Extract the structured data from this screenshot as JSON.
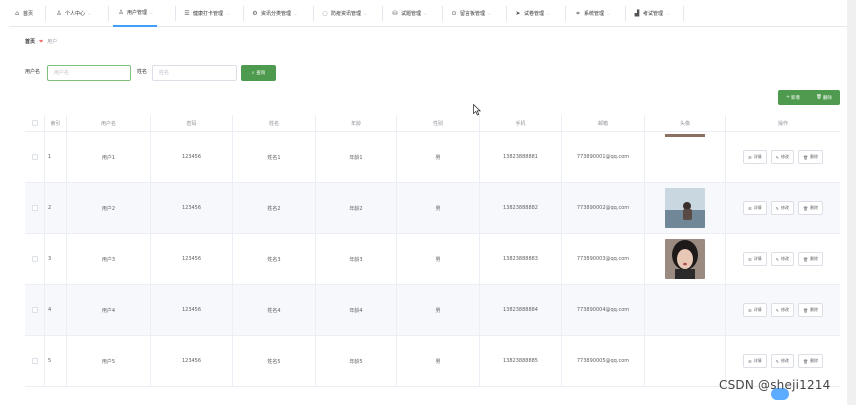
{
  "topnav": {
    "items": [
      {
        "label": "首页",
        "icon": "home-icon"
      },
      {
        "label": "个人中心",
        "icon": "user-icon"
      },
      {
        "label": "用户管理",
        "icon": "user-icon"
      },
      {
        "label": "健康打卡管理",
        "icon": "list-icon"
      },
      {
        "label": "资讯分类管理",
        "icon": "gear-icon"
      },
      {
        "label": "防疫资讯管理",
        "icon": "chat-icon"
      },
      {
        "label": "试题管理",
        "icon": "database-icon"
      },
      {
        "label": "留言板管理",
        "icon": "pin-icon"
      },
      {
        "label": "试卷管理",
        "icon": "send-icon"
      },
      {
        "label": "系统管理",
        "icon": "crop-icon"
      },
      {
        "label": "考试管理",
        "icon": "chart-icon"
      }
    ]
  },
  "breadcrumb": {
    "home": "首页",
    "current": "用户"
  },
  "search": {
    "username_label": "用户名",
    "username_placeholder": "用户名",
    "name_label": "姓名",
    "name_placeholder": "姓名",
    "button_label": "查询"
  },
  "actions": {
    "add_label": "新增",
    "delete_label": "删除"
  },
  "table": {
    "headers": [
      "索引",
      "用户名",
      "密码",
      "姓名",
      "年龄",
      "性别",
      "手机",
      "邮箱",
      "头像",
      "操作"
    ],
    "row_ops": [
      "详情",
      "修改",
      "删除"
    ],
    "rows": [
      {
        "index": "1",
        "username": "用户1",
        "password": "123456",
        "name": "姓名1",
        "age": "年龄1",
        "gender": "男",
        "phone": "13823888881",
        "email": "773890001@qq.com",
        "avatar": "none"
      },
      {
        "index": "2",
        "username": "用户2",
        "password": "123456",
        "name": "姓名2",
        "age": "年龄2",
        "gender": "男",
        "phone": "13823888882",
        "email": "773890002@qq.com",
        "avatar": "photo-seaside"
      },
      {
        "index": "3",
        "username": "用户3",
        "password": "123456",
        "name": "姓名3",
        "age": "年龄3",
        "gender": "男",
        "phone": "13823888883",
        "email": "773890003@qq.com",
        "avatar": "photo-portrait"
      },
      {
        "index": "4",
        "username": "用户4",
        "password": "123456",
        "name": "姓名4",
        "age": "年龄4",
        "gender": "男",
        "phone": "13823888884",
        "email": "773890004@qq.com",
        "avatar": "none"
      },
      {
        "index": "5",
        "username": "用户5",
        "password": "123456",
        "name": "姓名5",
        "age": "年龄5",
        "gender": "男",
        "phone": "13823888885",
        "email": "773890005@qq.com",
        "avatar": "none"
      }
    ]
  },
  "watermark": "CSDN @sheji1214",
  "colors": {
    "primary": "#409eff",
    "success": "#4e9a4e",
    "danger": "#f56c6c"
  }
}
